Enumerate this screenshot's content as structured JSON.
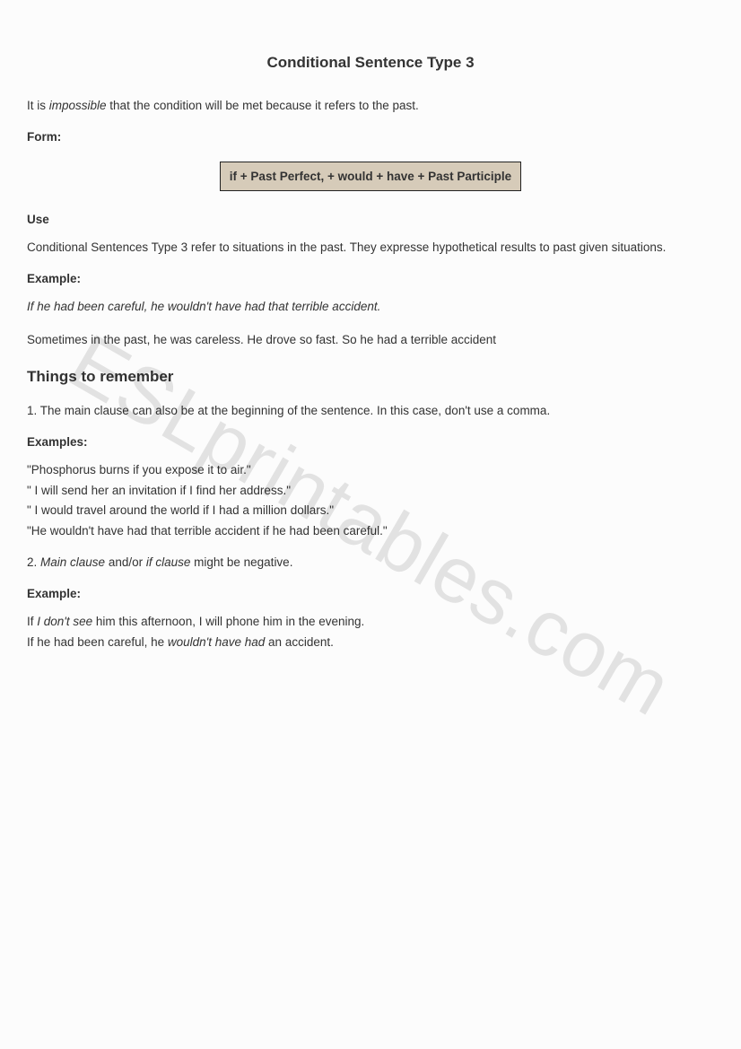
{
  "title": "Conditional Sentence Type 3",
  "intro_pre": "It is ",
  "intro_em": "impossible",
  "intro_post": " that the condition will be met because it refers to the past.",
  "form_label": "Form",
  "form_box": "if + Past Perfect, + would + have + Past Participle",
  "use_label": "Use",
  "use_para": "Conditional Sentences Type 3 refer to situations in the past. They expresse hypothetical results to past given situations.",
  "example_label": "Example:",
  "example_line": "If he had been careful, he wouldn't have had that terrible accident.",
  "example_explain": "Sometimes in the past, he was careless. He drove so fast. So he had a terrible accident",
  "remember_heading": "Things to remember",
  "point1": "1. The main clause can also be at the beginning of the sentence. In this case, don't use a comma.",
  "examples_label": "Examples:",
  "examples_list": [
    "\"Phosphorus burns if you expose it to air.\"",
    "\" I will send her an invitation if I find her address.\"",
    "\" I would travel around the world if I had a million dollars.\"",
    "\"He wouldn't have had that terrible accident if he had been careful.\""
  ],
  "point2_pre": "2. ",
  "point2_em1": "Main clause",
  "point2_mid": " and/or ",
  "point2_em2": "if clause",
  "point2_post": " might be negative.",
  "ex2_label": "Example:",
  "ex2_line1_pre": "If ",
  "ex2_line1_em": "I don't see",
  "ex2_line1_post": " him this afternoon, I will phone him in the evening.",
  "ex2_line2_pre": "If he had been careful, he ",
  "ex2_line2_em": "wouldn't have had",
  "ex2_line2_post": " an accident.",
  "watermark": "ESLprintables.com"
}
